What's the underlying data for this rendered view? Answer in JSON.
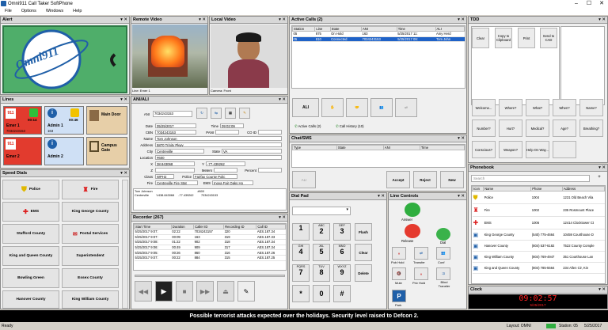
{
  "window": {
    "title": "Omni911 Call Taker SoftPhone",
    "controls": [
      "–",
      "☐",
      "✕"
    ]
  },
  "menu": [
    "File",
    "Options",
    "Windows",
    "Help"
  ],
  "panel_titles": {
    "alert": "Alert",
    "remote_video": "Remote Video",
    "local_video": "Local Video",
    "active_calls": "Active Calls (2)",
    "tdd": "TDD",
    "lines": "Lines",
    "ani_ali": "ANI/ALI",
    "chat_sms": "Chat/SMS",
    "speed_dials": "Speed Dials",
    "phonebook": "Phonebook",
    "recorder": "Recorder (267)",
    "dial_pad": "Dial Pad",
    "line_controls": "Line Controls",
    "clock": "Clock"
  },
  "alert": {
    "logo_text": "Omni911"
  },
  "remote_video": {
    "caption": "Line: Emer 1"
  },
  "local_video": {
    "caption": "Camera: Front"
  },
  "active_calls": {
    "columns": [
      "Station",
      "Line",
      "State",
      "ANI",
      "Time",
      "ALI"
    ],
    "rows": [
      [
        "05",
        "875",
        "On Hold",
        "163",
        "5/25/2017 11:",
        "Amy Herd"
      ],
      [
        "05",
        "810",
        "Connected",
        "7034243153",
        "5/25/2017 09:",
        "Tom John"
      ]
    ],
    "buttons": [
      "ALI",
      "Active Calls (2)",
      "Call History (10)"
    ]
  },
  "tdd": {
    "top_buttons": [
      "Clear",
      "Copy to Clipboard",
      "Print",
      "Send to CAD"
    ],
    "phrases": [
      "Welcome...",
      "Where?",
      "What?",
      "When?",
      "Name?",
      "Number?",
      "Hurt?",
      "Medical?",
      "Age?",
      "Breathing?",
      "Conscious?",
      "Weapon?",
      "Help On Way...",
      ""
    ]
  },
  "lines": [
    {
      "name": "Emer 1",
      "time": "00:14",
      "number": "7034243153",
      "style": "red",
      "badge": "911"
    },
    {
      "name": "Admin 1",
      "time": "00:46",
      "number": "163",
      "style": "blue",
      "badge": "i"
    },
    {
      "name": "Main Door",
      "time": "",
      "number": "",
      "style": "tan",
      "badge": "door"
    },
    {
      "name": "Emer 2",
      "time": "",
      "number": "",
      "style": "red",
      "badge": "911"
    },
    {
      "name": "Admin 2",
      "time": "",
      "number": "",
      "style": "blue",
      "badge": "i"
    },
    {
      "name": "Campus Gate",
      "time": "",
      "number": "",
      "style": "tan",
      "badge": "gate"
    }
  ],
  "ani_ali": {
    "ani": "7034243153",
    "date": "05/25/2017",
    "time": "09:02:09",
    "cbn": "7034243153",
    "pani": "",
    "co_id": "",
    "name": "Tom Johnson",
    "address": "5870 Trinity Pkwy",
    "city": "Centreville",
    "state": "VA",
    "location": "#600",
    "x": "38.843068",
    "y": "-77.439262",
    "z": "",
    "meters": "",
    "percent": "",
    "class": "WPH2",
    "police": "Fairfax County Polic",
    "fire": "Centreville Fire Stat",
    "ems": "Inova Fair Oaks Ho",
    "raw": "Tom Johnson                                                      #600\nCentreville         V438.843068     -77.439262         7034243153",
    "labels": {
      "ani": "ANI",
      "date": "Date",
      "time": "Time",
      "cbn": "CBN",
      "pani": "PANI",
      "co_id": "CO ID",
      "name": "Name",
      "address": "Address",
      "city": "City",
      "state": "State",
      "location": "Location",
      "x": "X",
      "y": "Y",
      "z": "Z",
      "meters": "Meters",
      "percent": "Percent",
      "class": "Class",
      "police": "Police",
      "fire": "Fire",
      "ems": "EMS"
    }
  },
  "chat": {
    "columns": [
      "Type",
      "State",
      "ANI",
      "Time"
    ],
    "buttons": [
      "ALI",
      "Accept",
      "Reject",
      "New"
    ]
  },
  "speed_dials": [
    [
      "Police",
      "Fire"
    ],
    [
      "EMS",
      "King George County"
    ],
    [
      "Stafford County",
      "Postal Services"
    ],
    [
      "King and Queen County",
      "Superintendent"
    ],
    [
      "Bowling Green",
      "Essex County"
    ],
    [
      "Hanover County",
      "King William County"
    ]
  ],
  "phonebook": {
    "search_placeholder": "Search",
    "columns": [
      "Icon",
      "Name",
      "Phone",
      "Address"
    ],
    "rows": [
      [
        "Police",
        "1004",
        "1231 Old Beach Vila"
      ],
      [
        "Fire",
        "1002",
        "235 Rosmount Place"
      ],
      [
        "EMS",
        "1006",
        "12414 Clocktower Ct"
      ],
      [
        "King George County",
        "(540) 775-4664",
        "10459 Courthouse D"
      ],
      [
        "Hanover County",
        "(804) 537-6182",
        "7522 County Comple"
      ],
      [
        "King William County",
        "(804) 769-4947",
        "351 Courthouse Lan"
      ],
      [
        "King and Queen County",
        "(804) 785-5564",
        "234 Allen Cir, Kin"
      ]
    ]
  },
  "recorder": {
    "columns": [
      "Start Time",
      "Duration",
      "Caller ID",
      "Recording ID",
      "Call ID"
    ],
    "rows": [
      [
        "5/25/2017 9:07:",
        "02:22",
        "7034243157",
        "320",
        "AES.187.34"
      ],
      [
        "5/25/2017 9:07:",
        "00:09",
        "163",
        "319",
        "AES.187.33"
      ],
      [
        "5/25/2017 9:08:",
        "01:22",
        "902",
        "318",
        "AES.187.34"
      ],
      [
        "5/25/2017 9:06:",
        "00:49",
        "909",
        "317",
        "AES.187.34"
      ],
      [
        "5/25/2017 9:05:",
        "00:26",
        "860",
        "316",
        "AES.187.26"
      ],
      [
        "5/25/2017 9:07:",
        "00:22",
        "884",
        "315",
        "AES.187.25"
      ]
    ]
  },
  "dialpad": {
    "keys": [
      [
        "1",
        ""
      ],
      [
        "2",
        "ABC"
      ],
      [
        "3",
        "DEF"
      ],
      [
        "4",
        "GHI"
      ],
      [
        "5",
        "JKL"
      ],
      [
        "6",
        "MNO"
      ],
      [
        "7",
        "PQRS"
      ],
      [
        "8",
        "TUV"
      ],
      [
        "9",
        "WXYZ"
      ],
      [
        "*",
        ""
      ],
      [
        "0",
        ""
      ],
      [
        "#",
        ""
      ]
    ],
    "side": [
      "Flash",
      "Clear",
      "Delete"
    ]
  },
  "line_controls": {
    "buttons": [
      "Answer",
      "Release",
      "Dial",
      "Pub Hold",
      "Transfer",
      "Conf",
      "Mute",
      "Priv Hold",
      "Blind Transfer",
      "Park"
    ]
  },
  "clock": {
    "time": "09:02:57",
    "date": "5/25/2017"
  },
  "ticker": "Possible terrorist attacks expected over the holidays.  Security level raised to Defcon 2.",
  "status": {
    "left": "Ready",
    "layout": "Layout: OMNI",
    "station": "Station: 05",
    "date": "5/25/2017"
  },
  "colors": {
    "alert_bg": "#4fae6a",
    "alert_border": "#2d7a46",
    "logo_blue": "#1f5fa8",
    "red_line": "#e23b2e",
    "clock_text": "#ff2020",
    "ticker_bg": "#000000",
    "call_selected": "#1f62c7"
  }
}
